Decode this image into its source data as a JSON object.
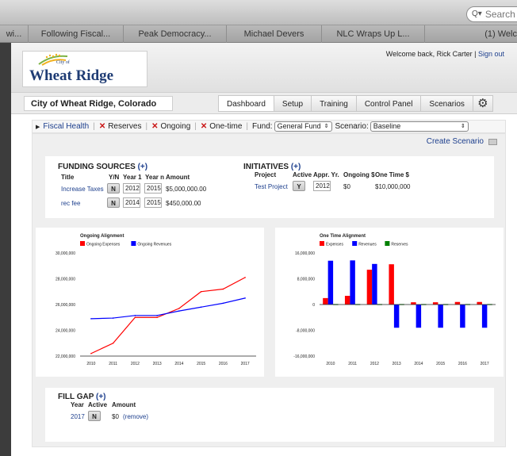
{
  "browser": {
    "search_placeholder": "Search",
    "tabs": [
      {
        "label": "wi..."
      },
      {
        "label": "Following Fiscal..."
      },
      {
        "label": "Peak Democracy..."
      },
      {
        "label": "Michael Devers"
      },
      {
        "label": "NLC Wraps Up L..."
      },
      {
        "label": "(1) Welc"
      }
    ]
  },
  "header": {
    "logo_city_of": "City of",
    "logo_text": "Wheat Ridge",
    "welcome": "Welcome back, Rick Carter |",
    "sign_out": "Sign out"
  },
  "nav": {
    "city_name": "City of Wheat Ridge, Colorado",
    "tabs": [
      {
        "label": "Dashboard"
      },
      {
        "label": "Setup"
      },
      {
        "label": "Training"
      },
      {
        "label": "Control Panel"
      },
      {
        "label": "Scenarios"
      }
    ]
  },
  "filter": {
    "fiscal_health": "Fiscal Health",
    "reserves": "Reserves",
    "ongoing": "Ongoing",
    "one_time": "One-time",
    "fund_label": "Fund:",
    "fund_value": "General Fund",
    "scenario_label": "Scenario:",
    "scenario_value": "Baseline",
    "create_scenario": "Create Scenario"
  },
  "funding": {
    "title": "FUNDING SOURCES",
    "plus": "(+)",
    "col_title": "Title",
    "col_yn": "Y/N",
    "col_year1": "Year 1",
    "col_yearn": "Year n",
    "col_amount": "Amount",
    "rows": [
      {
        "title": "Increase Taxes",
        "yn": "N",
        "year1": "2012",
        "yearn": "2015",
        "amount": "$5,000,000.00"
      },
      {
        "title": "rec fee",
        "yn": "N",
        "year1": "2014",
        "yearn": "2015",
        "amount": "$450,000.00"
      }
    ]
  },
  "initiatives": {
    "title": "INITIATIVES",
    "plus": "(+)",
    "col_project": "Project",
    "col_active": "Active",
    "col_appr": "Appr. Yr.",
    "col_ongoing": "Ongoing $",
    "col_onetime": "One Time $",
    "rows": [
      {
        "project": "Test Project",
        "active": "Y",
        "appr": "2012",
        "ongoing": "$0",
        "onetime": "$10,000,000"
      }
    ]
  },
  "chart_data": [
    {
      "type": "line",
      "title": "Ongoing Alignment",
      "x": [
        "2010",
        "2011",
        "2012",
        "2013",
        "2014",
        "2015",
        "2016",
        "2017"
      ],
      "series": [
        {
          "name": "Ongoing Expenses",
          "color": "#ff0000",
          "values": [
            22200000,
            23000000,
            25000000,
            25000000,
            25700000,
            27000000,
            27200000,
            28100000
          ]
        },
        {
          "name": "Ongoing Revenues",
          "color": "#0000ff",
          "values": [
            24900000,
            24950000,
            25150000,
            25150000,
            25500000,
            25800000,
            26100000,
            26500000
          ]
        }
      ],
      "y_ticks": [
        "30,000,000",
        "28,000,000",
        "26,000,000",
        "24,000,000",
        "22,000,000"
      ],
      "ylim": [
        22000000,
        30000000
      ],
      "grid": false,
      "legend": "top-left"
    },
    {
      "type": "bar",
      "title": "One Time Alignment",
      "categories": [
        "2010",
        "2011",
        "2012",
        "2013",
        "2014",
        "2015",
        "2016",
        "2017"
      ],
      "series": [
        {
          "name": "Expenses",
          "color": "#ff0000",
          "values": [
            2000000,
            2700000,
            10800000,
            12500000,
            700000,
            700000,
            800000,
            800000
          ]
        },
        {
          "name": "Revenues",
          "color": "#0000ff",
          "values": [
            13600000,
            13700000,
            12600000,
            -7200000,
            -7200000,
            -7200000,
            -7200000,
            -7200000
          ]
        },
        {
          "name": "Reserves",
          "color": "#008000",
          "values": [
            0,
            0,
            0,
            0,
            0,
            0,
            0,
            0
          ]
        }
      ],
      "y_ticks": [
        "16,000,000",
        "8,000,000",
        "0",
        "-8,000,000",
        "-16,000,000"
      ],
      "ylim": [
        -16000000,
        16000000
      ],
      "grid": false,
      "legend": "top-left"
    }
  ],
  "fill_gap": {
    "title": "FILL GAP",
    "plus": "(+)",
    "col_year": "Year",
    "col_active": "Active",
    "col_amount": "Amount",
    "rows": [
      {
        "year": "2017",
        "active": "N",
        "amount": "$0",
        "remove": "(remove)"
      }
    ]
  }
}
